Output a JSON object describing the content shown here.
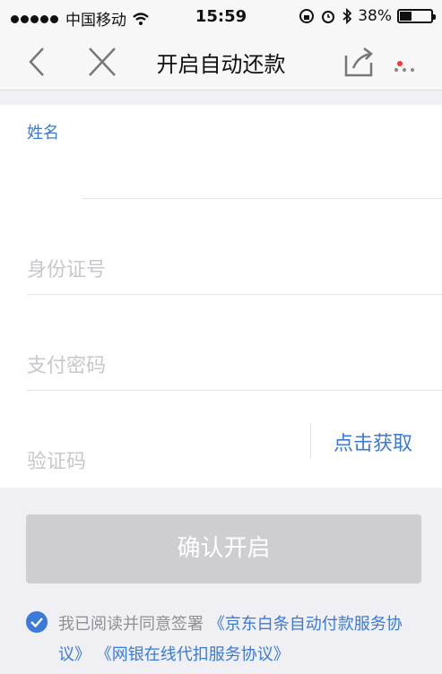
{
  "status": {
    "carrier": "中国移动",
    "time": "15:59",
    "battery": "38%",
    "battery_level": 0.38
  },
  "nav": {
    "title": "开启自动还款"
  },
  "form": {
    "name_label": "姓名",
    "id_placeholder": "身份证号",
    "password_placeholder": "支付密码",
    "code_placeholder": "验证码",
    "get_code": "点击获取"
  },
  "confirm_label": "确认开启",
  "agreement": {
    "prefix": "我已阅读并同意签署",
    "link1": "《京东白条自动付款服务协议》",
    "link2": "《网银在线代扣服务协议》"
  },
  "colors": {
    "accent": "#3a7ad9",
    "button_disabled": "#cecdd2",
    "notify_dot": "#f33333"
  }
}
